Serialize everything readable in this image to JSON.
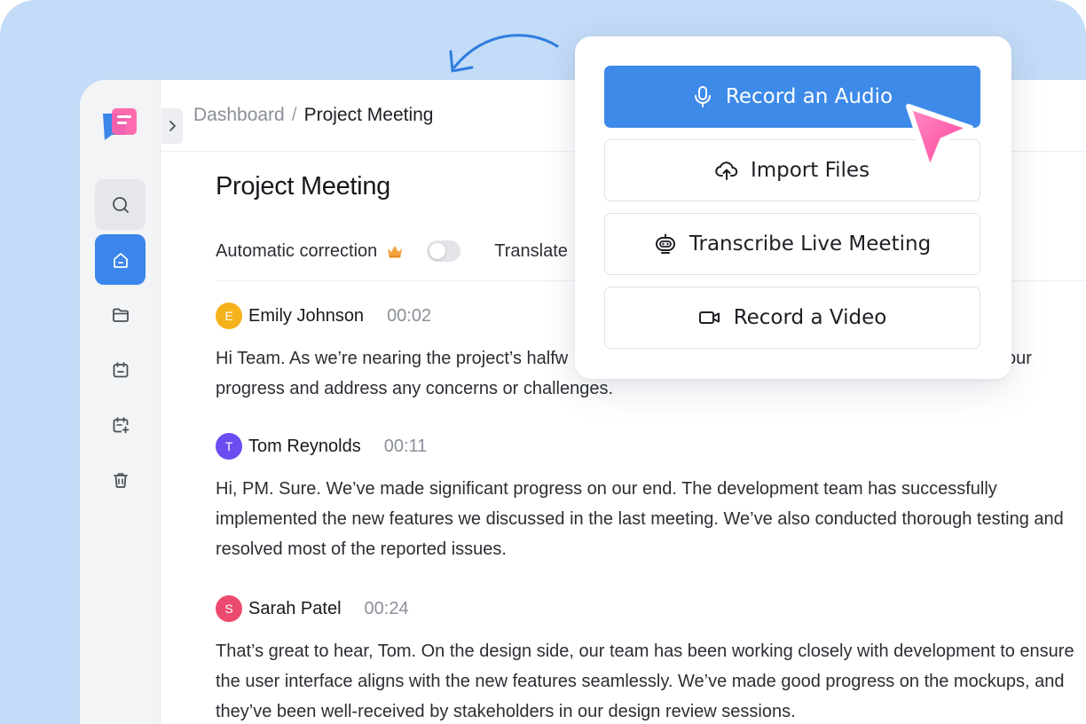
{
  "app": {
    "colors": {
      "accent": "#3b86ea",
      "sidebar_bg": "#f3f4f6",
      "backdrop": "#c3dcf7",
      "cursor": "#ff4fa0"
    }
  },
  "breadcrumb": {
    "root": "Dashboard",
    "separator": "/",
    "current": "Project Meeting"
  },
  "page": {
    "title": "Project Meeting"
  },
  "controls": {
    "auto_correction_label": "Automatic correction",
    "auto_correction_on": false,
    "translate_label": "Translate"
  },
  "sidebar": {
    "items": [
      {
        "icon": "search-icon",
        "active": false
      },
      {
        "icon": "home-icon",
        "active": true
      },
      {
        "icon": "folder-icon",
        "active": false
      },
      {
        "icon": "calendar-icon",
        "active": false
      },
      {
        "icon": "calendar-add-icon",
        "active": false
      },
      {
        "icon": "trash-icon",
        "active": false
      }
    ]
  },
  "messages": [
    {
      "initial": "E",
      "avatar_color": "#f6b21b",
      "speaker": "Emily Johnson",
      "time": "00:02",
      "lines": [
        "Hi Team. As we’re nearing the project’s halfw",
        "progress and address any concerns or challenges."
      ],
      "trailing": "our"
    },
    {
      "initial": "T",
      "avatar_color": "#6a4cf0",
      "speaker": "Tom Reynolds",
      "time": "00:11",
      "lines": [
        "Hi, PM. Sure. We’ve made significant progress on our end. The development team has successfully",
        "implemented the new features we discussed in the last meeting. We’ve also conducted thorough testing and",
        "resolved most of the reported issues."
      ]
    },
    {
      "initial": "S",
      "avatar_color": "#ec4a6e",
      "speaker": "Sarah Patel",
      "time": "00:24",
      "lines": [
        "That’s great to hear, Tom. On the design side, our team has been working closely with development to ensure",
        "the user interface aligns with the new features seamlessly. We’ve made good progress on the mockups, and",
        "they’ve been well-received by stakeholders in our design review sessions."
      ]
    }
  ],
  "popup": {
    "options": [
      {
        "label": "Record an Audio",
        "icon": "microphone-icon",
        "primary": true
      },
      {
        "label": "Import Files",
        "icon": "cloud-upload-icon",
        "primary": false
      },
      {
        "label": "Transcribe Live Meeting",
        "icon": "robot-icon",
        "primary": false
      },
      {
        "label": "Record a Video",
        "icon": "video-camera-icon",
        "primary": false
      }
    ]
  }
}
